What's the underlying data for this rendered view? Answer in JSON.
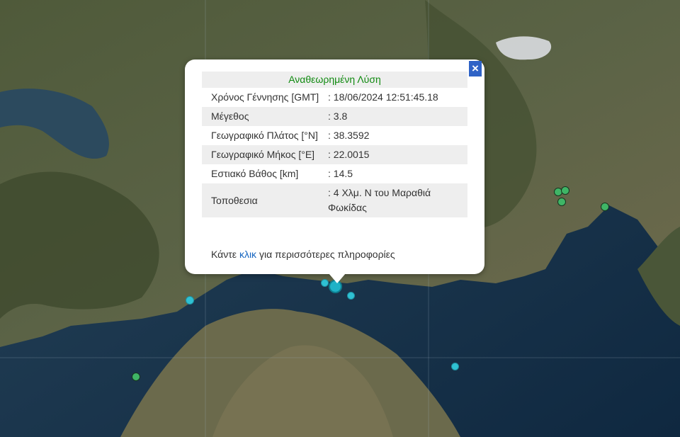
{
  "popup": {
    "heading": "Αναθεωρημένη Λύση",
    "close_icon": "close-icon",
    "rows": [
      {
        "label": "Χρόνος Γέννησης [GMT]",
        "value": ": 18/06/2024 12:51:45.18"
      },
      {
        "label": "Μέγεθος",
        "value": ": 3.8"
      },
      {
        "label": "Γεωγραφικό Πλάτος [°N]",
        "value": ": 38.3592"
      },
      {
        "label": "Γεωγραφικό Μήκος [°E]",
        "value": ": 22.0015"
      },
      {
        "label": "Εστιακό Βάθος [km]",
        "value": ": 14.5"
      },
      {
        "label": "Τοποθεσια",
        "value": ": 4 Χλμ. Ν του Μαραθιά Φωκίδας"
      }
    ],
    "more_prefix": "Κάντε",
    "more_link": "κλικ",
    "more_suffix": "για περισσότερες πληροφορίες"
  },
  "markers": {
    "colors": {
      "cyan": "#2fc1d3",
      "green": "#3fb566"
    }
  },
  "colors": {
    "heading": "#108a10",
    "link": "#1565c0",
    "close_button": "#2f63c6"
  }
}
